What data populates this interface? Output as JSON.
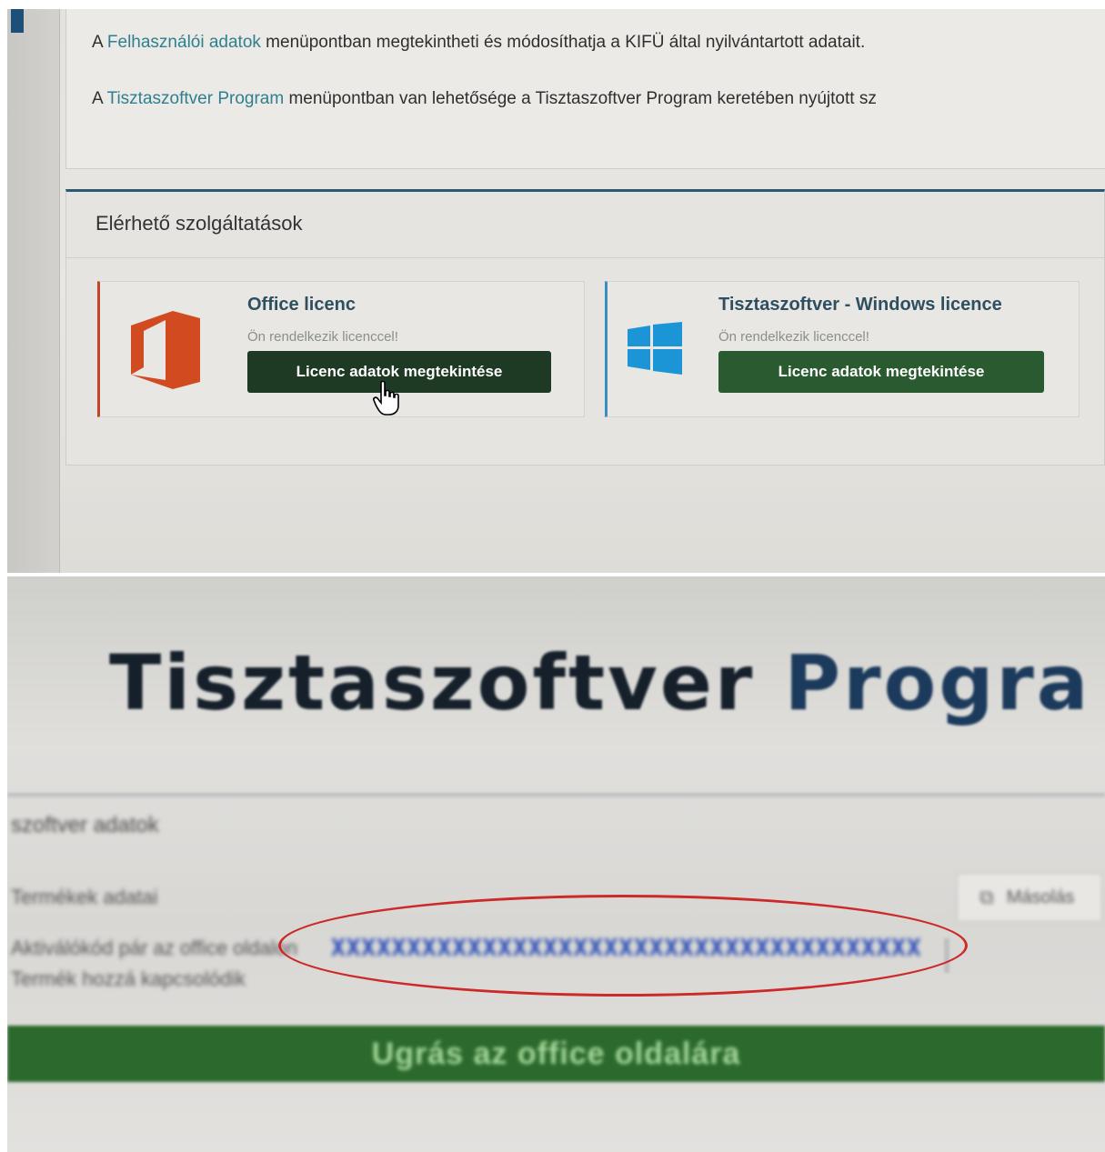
{
  "top": {
    "intro_line1": {
      "prefix": "A ",
      "link": "Felhasználói adatok",
      "suffix": " menüpontban megtekintheti és módosíthatja a KIFÜ által nyilvántartott adatait."
    },
    "intro_line2": {
      "prefix": "A ",
      "link": "Tisztaszoftver Program",
      "suffix": " menüpontban van lehetősége a Tisztaszoftver Program keretében nyújtott sz"
    },
    "services_title": "Elérhető szolgáltatások",
    "cards": [
      {
        "name": "Office licenc",
        "status": "Ön rendelkezik licenccel!",
        "button": "Licenc adatok megtekintése",
        "icon": "office-icon",
        "accent": "#c0452a"
      },
      {
        "name": "Tisztaszoftver - Windows licence",
        "status": "Ön rendelkezik licenccel!",
        "button": "Licenc adatok megtekintése",
        "icon": "windows-icon",
        "accent": "#3a8fc1"
      }
    ]
  },
  "bottom": {
    "title_part1": "Tisztaszoftver ",
    "title_part2": "Progra",
    "section_header": "szoftver adatok",
    "label1": "Termékek adatai",
    "label2": "Aktiválókód pár az office oldalon",
    "label3": "Termék hozzá kapcsolódik",
    "key_value": "XXXXXXXXXXXXXXXXXXXXXXXXXXXXXXXXXXXXXXXXXXXXXX",
    "copy_button": "Másolás",
    "green_button": "Ugrás az office oldalára",
    "highlight_color": "#cc2a2a"
  }
}
